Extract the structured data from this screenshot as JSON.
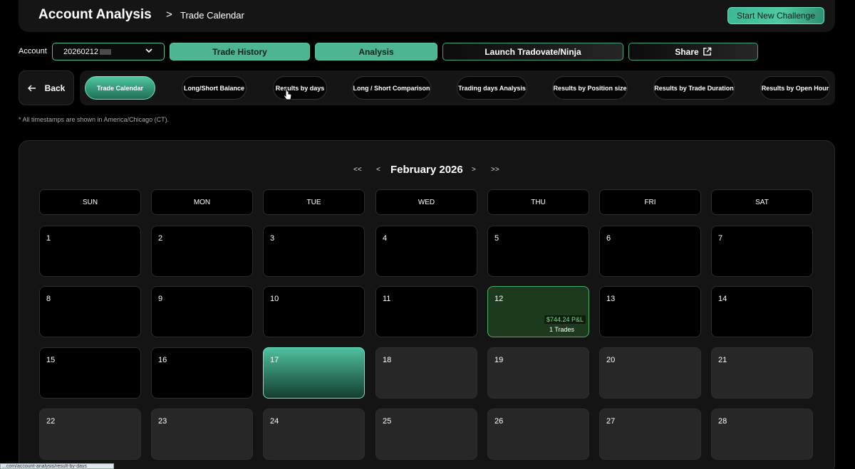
{
  "header": {
    "title": "Account Analysis",
    "breadcrumb_sep": ">",
    "breadcrumb": "Trade Calendar",
    "start_challenge": "Start New Challenge"
  },
  "account": {
    "label": "Account",
    "value": "20260212"
  },
  "top_buttons": {
    "trade_history": "Trade History",
    "analysis": "Analysis",
    "launch": "Launch Tradovate/Ninja",
    "share": "Share"
  },
  "back_label": "Back",
  "tabs": [
    "Trade Calendar",
    "Long/Short Balance",
    "Results by days",
    "Long / Short Comparison",
    "Trading days Analysis",
    "Results by Position size",
    "Results by Trade Duration",
    "Results by Open Hour"
  ],
  "timezone_note": "* All timestamps are shown in America/Chicago (CT).",
  "calendar": {
    "month": "February 2026",
    "nav_first": "<<",
    "nav_prev": "<",
    "nav_next": ">",
    "nav_last": ">>",
    "weekdays": [
      "SUN",
      "MON",
      "TUE",
      "WED",
      "THU",
      "FRI",
      "SAT"
    ],
    "days": [
      {
        "n": "1",
        "state": "past"
      },
      {
        "n": "2",
        "state": "past"
      },
      {
        "n": "3",
        "state": "past"
      },
      {
        "n": "4",
        "state": "past"
      },
      {
        "n": "5",
        "state": "past"
      },
      {
        "n": "6",
        "state": "past"
      },
      {
        "n": "7",
        "state": "past"
      },
      {
        "n": "8",
        "state": "past"
      },
      {
        "n": "9",
        "state": "past"
      },
      {
        "n": "10",
        "state": "past"
      },
      {
        "n": "11",
        "state": "past"
      },
      {
        "n": "12",
        "state": "profit",
        "pnl": "$744.24 P&L",
        "trades": "1 Trades"
      },
      {
        "n": "13",
        "state": "past"
      },
      {
        "n": "14",
        "state": "past"
      },
      {
        "n": "15",
        "state": "past"
      },
      {
        "n": "16",
        "state": "past"
      },
      {
        "n": "17",
        "state": "today"
      },
      {
        "n": "18",
        "state": "future"
      },
      {
        "n": "19",
        "state": "future"
      },
      {
        "n": "20",
        "state": "future"
      },
      {
        "n": "21",
        "state": "future"
      },
      {
        "n": "22",
        "state": "future"
      },
      {
        "n": "23",
        "state": "future"
      },
      {
        "n": "24",
        "state": "future"
      },
      {
        "n": "25",
        "state": "future"
      },
      {
        "n": "26",
        "state": "future"
      },
      {
        "n": "27",
        "state": "future"
      },
      {
        "n": "28",
        "state": "future"
      }
    ]
  },
  "status_url": "...com/account-analysis/result-by-days",
  "colors": {
    "accent": "#4db592",
    "profit": "#7be08a",
    "panel": "#151515"
  }
}
